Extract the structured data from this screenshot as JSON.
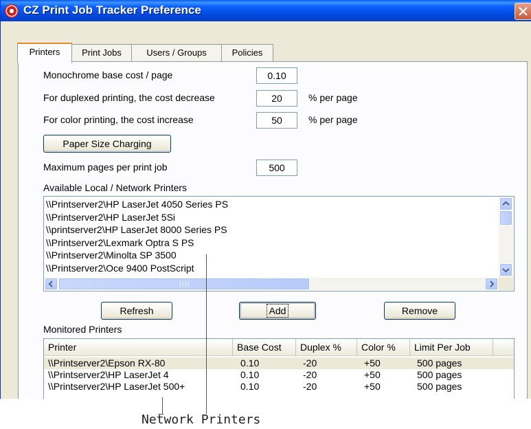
{
  "window": {
    "title": "CZ Print Job Tracker Preference"
  },
  "tabs": [
    {
      "label": "Printers",
      "active": true
    },
    {
      "label": "Print Jobs",
      "active": false
    },
    {
      "label": "Users / Groups",
      "active": false
    },
    {
      "label": "Policies",
      "active": false
    }
  ],
  "settings": {
    "mono_cost_label": "Monochrome base cost / page",
    "mono_cost_value": "0.10",
    "duplex_label": "For duplexed printing, the cost decrease",
    "duplex_value": "20",
    "duplex_unit": "% per page",
    "color_label": "For color printing, the cost increase",
    "color_value": "50",
    "color_unit": "% per page",
    "paper_size_button": "Paper Size Charging",
    "max_pages_label": "Maximum pages per print job",
    "max_pages_value": "500"
  },
  "available": {
    "label": "Available Local / Network Printers",
    "items": [
      "\\\\Printserver2\\HP LaserJet 4050 Series PS",
      "\\\\Printserver2\\HP LaserJet 5Si",
      "\\\\printserver2\\HP LaserJet 8000 Series PS",
      "\\\\Printserver2\\Lexmark Optra S PS",
      "\\\\Printserver2\\Minolta SP 3500",
      "\\\\Printserver2\\Oce 9400 PostScript"
    ]
  },
  "buttons": {
    "refresh": "Refresh",
    "add": "Add",
    "remove": "Remove"
  },
  "monitored": {
    "label": "Monitored Printers",
    "columns": [
      "Printer",
      "Base Cost",
      "Duplex %",
      "Color %",
      "Limit Per Job"
    ],
    "rows": [
      [
        "\\\\Printserver2\\Epson RX-80",
        "0.10",
        "-20",
        "+50",
        "500 pages"
      ],
      [
        "\\\\Printserver2\\HP LaserJet 4",
        "0.10",
        "-20",
        "+50",
        "500 pages"
      ],
      [
        "\\\\Printserver2\\HP LaserJet 500+",
        "0.10",
        "-20",
        "+50",
        "500 pages"
      ]
    ]
  },
  "annotation": {
    "text": "Network Printers"
  },
  "colors": {
    "titlebar": "#0054e3",
    "tab_highlight": "#e68b2c",
    "dialog_bg": "#ece9d8"
  }
}
